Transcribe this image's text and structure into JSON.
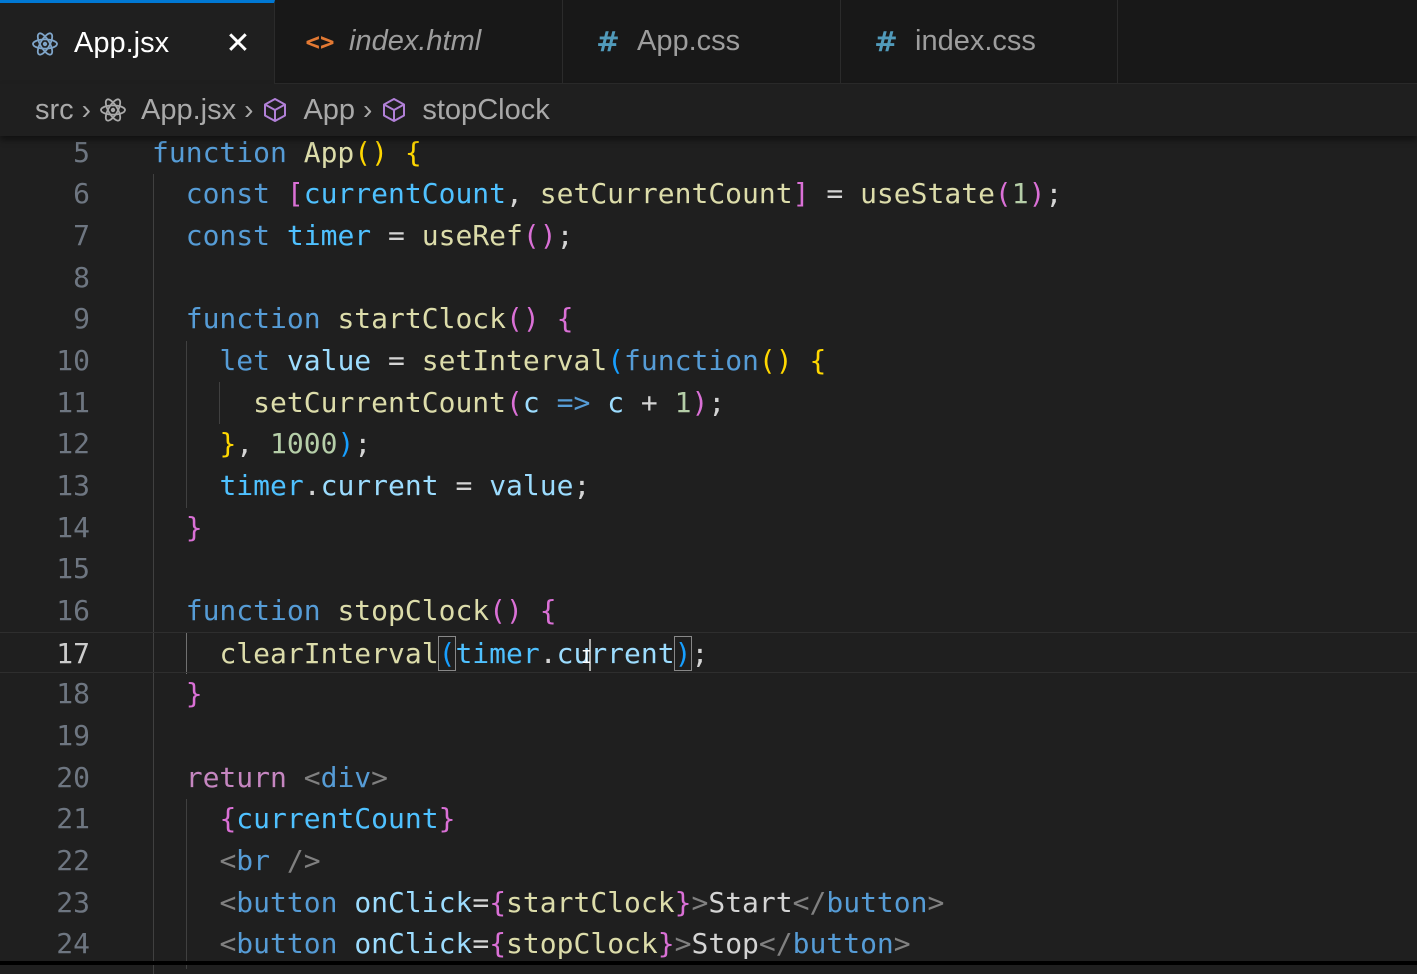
{
  "tabs": [
    {
      "label": "App.jsx",
      "icon": "react-icon",
      "active": true,
      "close": "✕"
    },
    {
      "label": "index.html",
      "icon": "html-icon",
      "glyph": "<>"
    },
    {
      "label": "App.css",
      "icon": "css-icon",
      "glyph": "#"
    },
    {
      "label": "index.css",
      "icon": "css-icon",
      "glyph": "#"
    }
  ],
  "breadcrumb": {
    "folder": "src",
    "file": "App.jsx",
    "component": "App",
    "symbol": "stopClock",
    "separator": "›"
  },
  "editor": {
    "current_line": 17,
    "line_numbers": [
      "5",
      "6",
      "7",
      "8",
      "9",
      "10",
      "11",
      "12",
      "13",
      "14",
      "15",
      "16",
      "17",
      "18",
      "19",
      "20",
      "21",
      "22",
      "23",
      "24"
    ]
  },
  "colors": {
    "accent": "#0078d4",
    "background": "#1f1f1f",
    "keyword": "#569cd6",
    "function": "#dcdcaa",
    "variable": "#9cdcfe"
  }
}
